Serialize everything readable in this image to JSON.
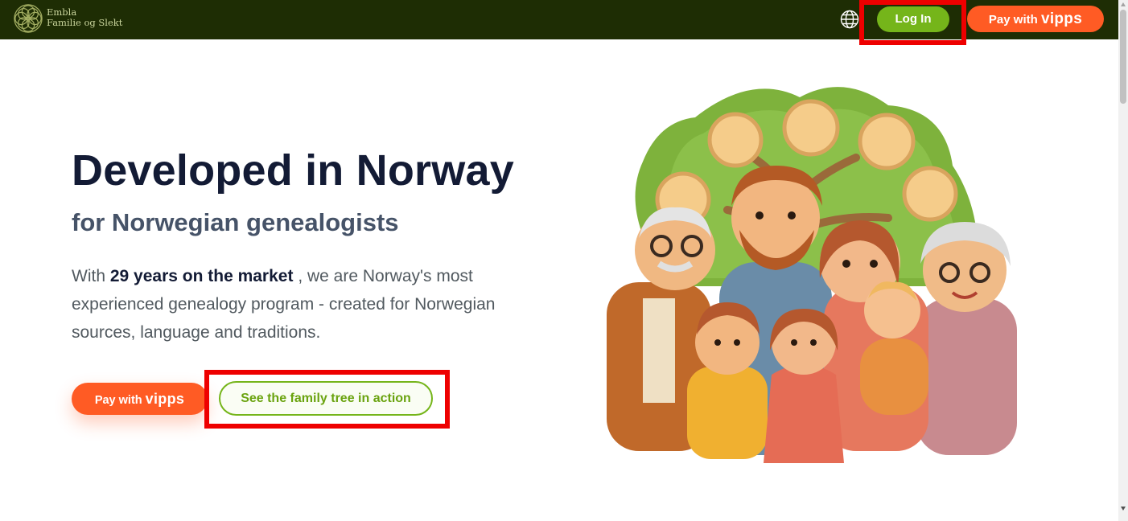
{
  "header": {
    "brand_line1": "Embla",
    "brand_line2": "Familie og Slekt",
    "login_label": "Log In",
    "pay_prefix": "Pay with",
    "pay_brand": "vipps"
  },
  "hero": {
    "title": "Developed in Norway",
    "subtitle": "for Norwegian genealogists",
    "para_intro": "With",
    "para_bold": "29 years on the market",
    "para_rest": ", we are Norway's most experienced genealogy program - created for Norwegian sources, language and traditions.",
    "pay_prefix": "Pay with",
    "pay_brand": "vipps",
    "tree_button": "See the family tree in action"
  },
  "icons": {
    "logo": "celtic-knot-logo-icon",
    "language": "globe-icon",
    "illustration": "family-tree-illustration"
  },
  "colors": {
    "nav_bg": "#1e2d04",
    "accent_green": "#75b51a",
    "vipps_orange": "#ff5b24",
    "heading": "#131b35",
    "highlight_outline": "#ee0000"
  }
}
